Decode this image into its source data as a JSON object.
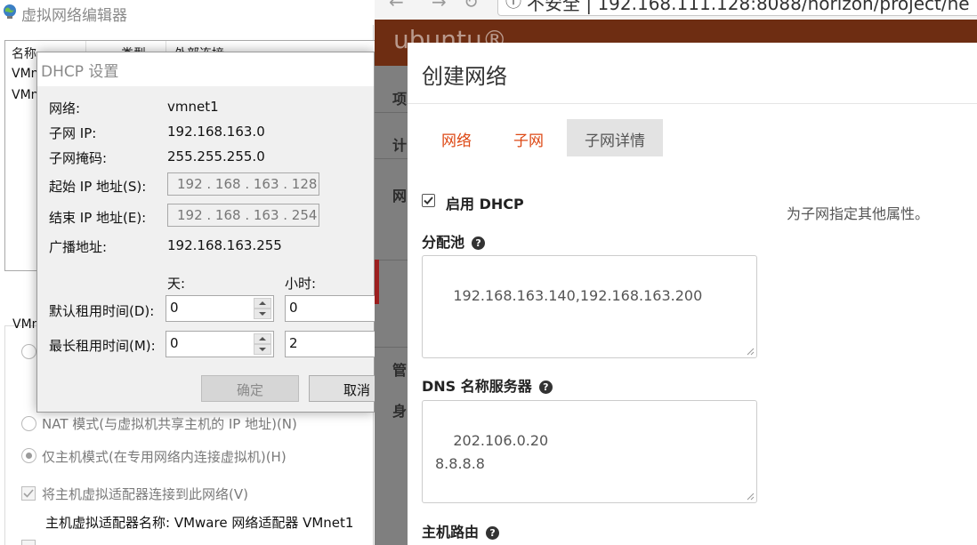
{
  "vne": {
    "title": "虚拟网络编辑器",
    "table": {
      "headers": [
        "名称",
        "类型",
        "外部连接"
      ],
      "rows": [
        "VMn",
        "VMn"
      ]
    },
    "group_label": "VMn",
    "modes": [
      {
        "label": "NAT 模式(与虚拟机共享主机的 IP 地址)(N)",
        "selected": false
      },
      {
        "label": "仅主机模式(在专用网络内连接虚拟机)(H)",
        "selected": true
      }
    ],
    "connect_adapter_label": "将主机虚拟适配器连接到此网络(V)",
    "adapter_name_line": "主机虚拟适配器名称: VMware 网络适配器 VMnet1"
  },
  "dhcp_dialog": {
    "title": "DHCP 设置",
    "network_label": "网络:",
    "network_value": "vmnet1",
    "subnet_ip_label": "子网 IP:",
    "subnet_ip_value": "192.168.163.0",
    "subnet_mask_label": "子网掩码:",
    "subnet_mask_value": "255.255.255.0",
    "start_ip_label": "起始 IP 地址(S):",
    "start_ip_value": "192 . 168 . 163 . 128",
    "end_ip_label": "结束 IP 地址(E):",
    "end_ip_value": "192 . 168 . 163 . 254",
    "broadcast_label": "广播地址:",
    "broadcast_value": "192.168.163.255",
    "days_label": "天:",
    "hours_label": "小时:",
    "default_lease_label": "默认租用时间(D):",
    "default_lease_days": "0",
    "default_lease_hours": "0",
    "max_lease_label": "最长租用时间(M):",
    "max_lease_days": "0",
    "max_lease_hours": "2",
    "ok_label": "确定",
    "cancel_label": "取消"
  },
  "browser": {
    "url_text": "不安全 | 192.168.111.128:8088/horizon/project/ne"
  },
  "horizon": {
    "logo": "ubuntu®",
    "sidebar_fragments": [
      "项",
      "计",
      "网",
      "管",
      "身"
    ],
    "modal": {
      "title": "创建网络",
      "tabs": [
        "网络",
        "子网",
        "子网详情"
      ],
      "active_tab": "子网详情",
      "enable_dhcp_label": "启用 DHCP",
      "enable_dhcp_checked": true,
      "help_text": "为子网指定其他属性。",
      "allocation_pool_label": "分配池",
      "allocation_pool_value": "192.168.163.140,192.168.163.200",
      "dns_label": "DNS 名称服务器",
      "dns_value": "202.106.0.20\n8.8.8.8",
      "host_routes_label": "主机路由"
    }
  }
}
